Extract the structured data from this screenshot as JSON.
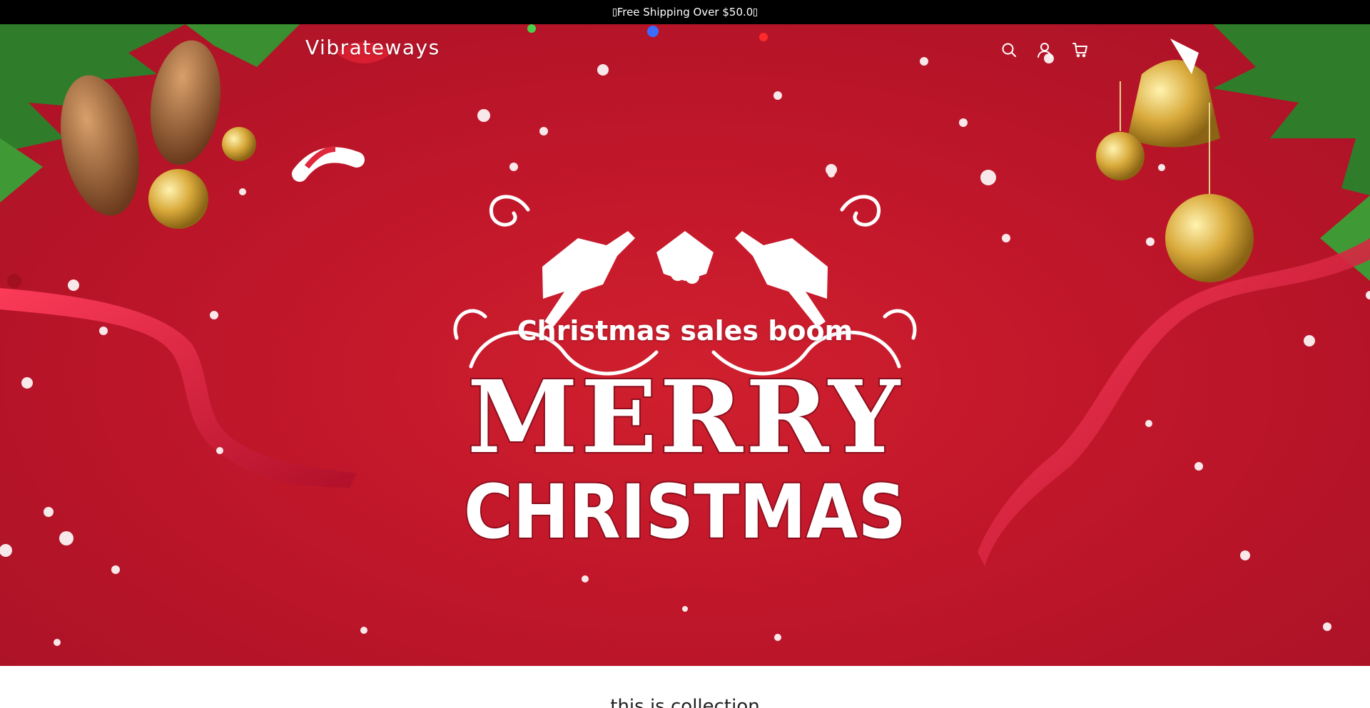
{
  "announcement": {
    "text": "Free Shipping Over $50.0"
  },
  "header": {
    "brand": "Vibrateways",
    "icons": [
      "search-icon",
      "account-icon",
      "cart-icon"
    ]
  },
  "hero": {
    "heading": "Christmas sales boom",
    "artwork_line1": "MERRY",
    "artwork_line2": "CHRISTMAS"
  },
  "collection": {
    "title": "this is collection"
  },
  "colors": {
    "announcement_bg": "#000000",
    "hero_red": "#c0162a",
    "text_light": "#ffffff"
  }
}
